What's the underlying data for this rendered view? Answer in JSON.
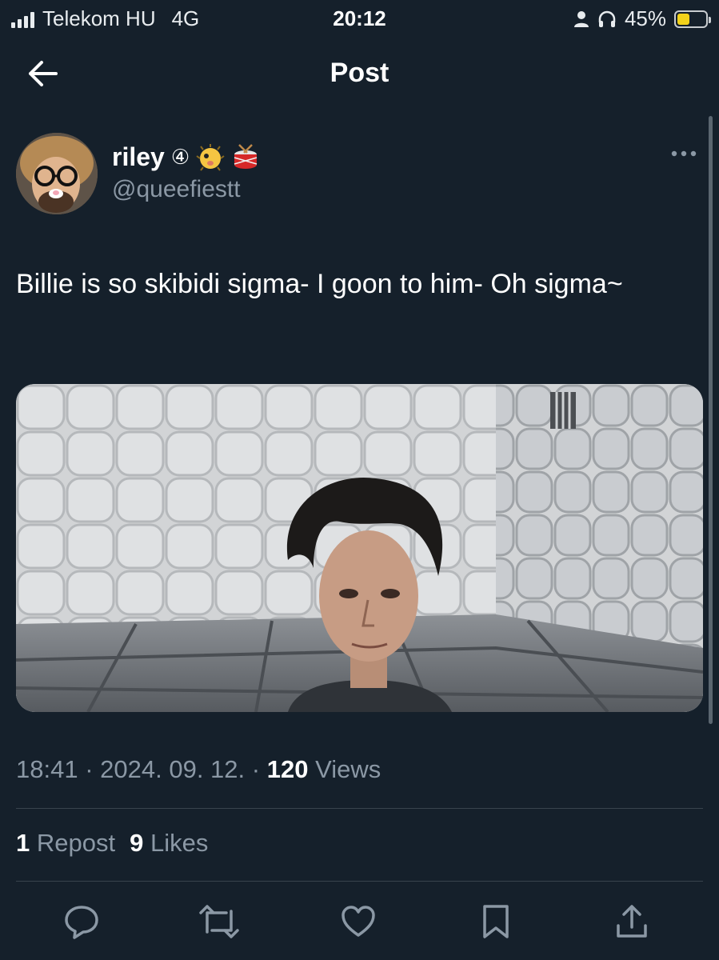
{
  "status_bar": {
    "carrier": "Telekom HU",
    "network": "4G",
    "time": "20:12",
    "battery_percent_label": "45%",
    "battery_level": 0.45,
    "battery_color": "#f2d21b",
    "icons": [
      "signal-icon",
      "person-icon",
      "headphones-icon",
      "battery-icon"
    ]
  },
  "nav": {
    "title": "Post",
    "back_icon": "arrow-left-icon"
  },
  "author": {
    "display_name": "riley",
    "circled_number": "④",
    "badges": [
      "blowfish-emoji-icon",
      "drum-emoji-icon"
    ],
    "handle": "@queefiestt"
  },
  "post": {
    "text": "Billie is so skibidi sigma- I goon to him- Oh sigma~",
    "media": "padded-room-photo"
  },
  "meta": {
    "time": "18:41",
    "separator": "·",
    "date": "2024. 09. 12.",
    "views_count": "120",
    "views_label": "Views"
  },
  "stats": {
    "reposts_count": "1",
    "reposts_label": "Repost",
    "likes_count": "9",
    "likes_label": "Likes"
  },
  "actions": [
    "reply-icon",
    "repost-icon",
    "like-icon",
    "bookmark-icon",
    "share-icon"
  ],
  "colors": {
    "background": "#15202b",
    "text_primary": "#ffffff",
    "text_secondary": "#8b98a5",
    "divider": "#38444d"
  }
}
